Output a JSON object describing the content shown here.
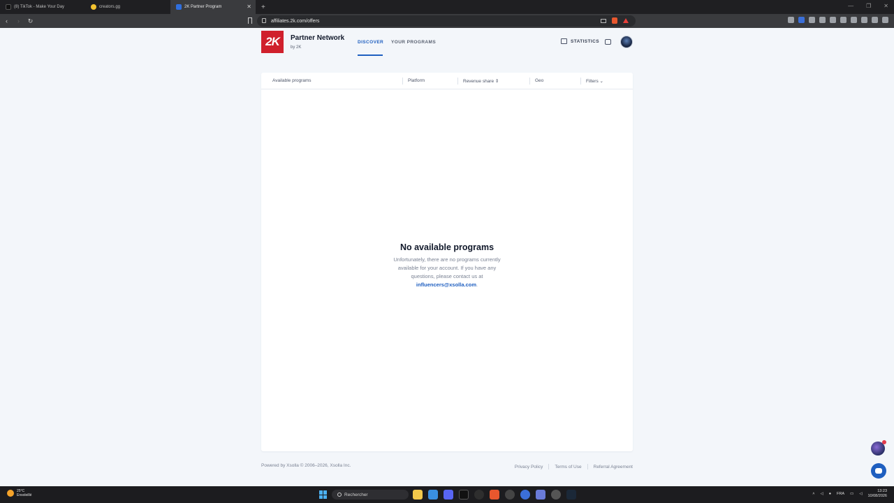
{
  "browser": {
    "tabs": [
      {
        "label": "(8) TikTok - Make Your Day",
        "favicon_color": "#111111",
        "active": false
      },
      {
        "label": "creators.gg",
        "favicon_color": "#f2c230",
        "active": false
      },
      {
        "label": "2K Partner Program",
        "favicon_color": "#2f6fde",
        "active": true
      }
    ],
    "url": "affiliates.2k.com/offers"
  },
  "brand": {
    "logo_text": "2K",
    "title": "Partner Network",
    "subtitle": "by 2K",
    "logo_color": "#d0202c"
  },
  "nav": {
    "discover": "DISCOVER",
    "your_programs": "YOUR PROGRAMS",
    "statistics": "STATISTICS"
  },
  "table": {
    "columns": {
      "available_programs": "Available programs",
      "platform": "Platform",
      "revenue_share": "Revenue share ⇕",
      "geo": "Geo",
      "filters": "Filters ⌄"
    }
  },
  "empty_state": {
    "title": "No available programs",
    "text": "Unfortunately, there are no programs currently available for your account. If you have any questions, please contact us at ",
    "email": "influencers@xsolla.com",
    "period": "."
  },
  "footer": {
    "powered": "Powered by Xsolla © 2006–2026, Xsolla Inc.",
    "privacy": "Privacy Policy",
    "terms": "Terms of Use",
    "referral": "Referral Agreement"
  },
  "taskbar": {
    "weather_temp": "25°C",
    "weather_desc": "Ensoleillé",
    "search": "Rechercher",
    "lang": "FRA",
    "time": "13:23",
    "date": "10/08/2026"
  },
  "colors": {
    "accent": "#1f5fc0",
    "page_bg": "#f3f6fa"
  }
}
